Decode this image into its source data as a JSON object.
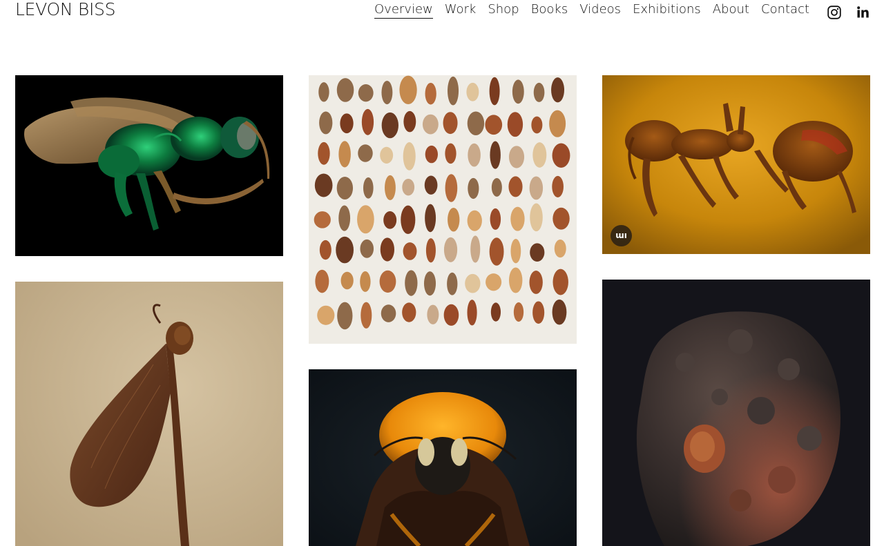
{
  "site": {
    "logo": "LEVON BISS"
  },
  "nav": {
    "items": [
      {
        "label": "Overview",
        "active": true
      },
      {
        "label": "Work"
      },
      {
        "label": "Shop"
      },
      {
        "label": "Books"
      },
      {
        "label": "Videos"
      },
      {
        "label": "Exhibitions"
      },
      {
        "label": "About"
      },
      {
        "label": "Contact"
      }
    ]
  },
  "social": {
    "icons": [
      "instagram-icon",
      "linkedin-icon"
    ]
  },
  "gallery": {
    "badge_text": "ɯı",
    "tiles": [
      {
        "subject": "emerald-wasp-photo"
      },
      {
        "subject": "seed-collection-photo"
      },
      {
        "subject": "amber-ant-photo"
      },
      {
        "subject": "samara-seed-photo"
      },
      {
        "subject": "bumblebee-photo"
      },
      {
        "subject": "textured-seed-photo"
      }
    ]
  },
  "colors": {
    "text": "#111111",
    "background": "#ffffff"
  }
}
